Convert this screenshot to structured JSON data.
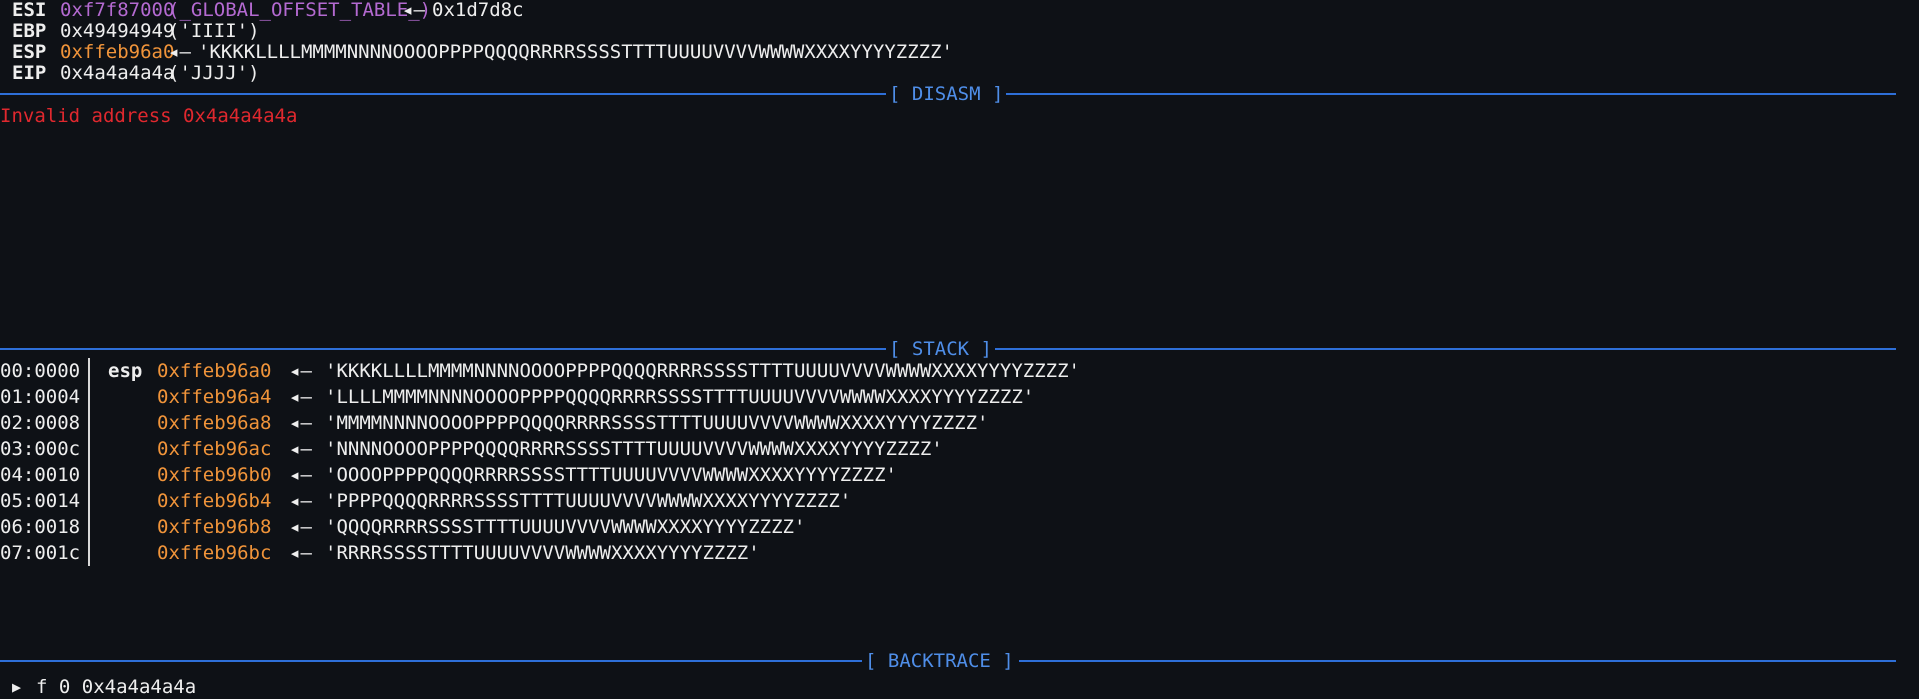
{
  "registers": [
    {
      "name": "ESI",
      "value": "0xf7f87000",
      "symbol": "(_GLOBAL_OFFSET_TABLE_)",
      "arrow": "◂—",
      "target": "0x1d7d8c"
    },
    {
      "name": "EBP",
      "value": "0x49494949",
      "symbol": "",
      "arrow": "",
      "target": "('IIII')"
    },
    {
      "name": "ESP",
      "value": "0xffeb96a0",
      "symbol": "",
      "arrow": "◂—",
      "target": "'KKKKLLLLMMMMNNNNOOOOPPPPQQQQRRRRSSSSTTTTUUUUVVVVWWWWXXXXYYYYZZZZ'"
    },
    {
      "name": "EIP",
      "value": "0x4a4a4a4a",
      "symbol": "",
      "arrow": "",
      "target": "('JJJJ')"
    }
  ],
  "sections": {
    "disasm": "[ DISASM ]",
    "stack": "[ STACK ]",
    "backtrace": "[ BACKTRACE ]"
  },
  "disasm": {
    "message": "Invalid address 0x4a4a4a4a"
  },
  "stack": [
    {
      "offset": "00:0000",
      "label": "esp",
      "addr": "0xffeb96a0",
      "arrow": "◂—",
      "value": "'KKKKLLLLMMMMNNNNOOOOPPPPQQQQRRRRSSSSTTTTUUUUVVVVWWWWXXXXYYYYZZZZ'"
    },
    {
      "offset": "01:0004",
      "label": "",
      "addr": "0xffeb96a4",
      "arrow": "◂—",
      "value": "'LLLLMMMMNNNNOOOOPPPPQQQQRRRRSSSSTTTTUUUUVVVVWWWWXXXXYYYYZZZZ'"
    },
    {
      "offset": "02:0008",
      "label": "",
      "addr": "0xffeb96a8",
      "arrow": "◂—",
      "value": "'MMMMNNNNOOOOPPPPQQQQRRRRSSSSTTTTUUUUVVVVWWWWXXXXYYYYZZZZ'"
    },
    {
      "offset": "03:000c",
      "label": "",
      "addr": "0xffeb96ac",
      "arrow": "◂—",
      "value": "'NNNNOOOOPPPPQQQQRRRRSSSSTTTTUUUUVVVVWWWWXXXXYYYYZZZZ'"
    },
    {
      "offset": "04:0010",
      "label": "",
      "addr": "0xffeb96b0",
      "arrow": "◂—",
      "value": "'OOOOPPPPQQQQRRRRSSSSTTTTUUUUVVVVWWWWXXXXYYYYZZZZ'"
    },
    {
      "offset": "05:0014",
      "label": "",
      "addr": "0xffeb96b4",
      "arrow": "◂—",
      "value": "'PPPPQQQQRRRRSSSSTTTTUUUUVVVVWWWWXXXXYYYYZZZZ'"
    },
    {
      "offset": "06:0018",
      "label": "",
      "addr": "0xffeb96b8",
      "arrow": "◂—",
      "value": "'QQQQRRRRSSSSTTTTUUUUVVVVWWWWXXXXYYYYZZZZ'"
    },
    {
      "offset": "07:001c",
      "label": "",
      "addr": "0xffeb96bc",
      "arrow": "◂—",
      "value": "'RRRRSSSSTTTTUUUUVVVVWWWWXXXXYYYYZZZZ'"
    }
  ],
  "backtrace": {
    "marker": "▶",
    "frame": "f 0 0x4a4a4a4a"
  },
  "colors": {
    "background": "#0e1116",
    "text": "#e6e6e6",
    "symbol": "#b46ad1",
    "stack_address": "#f0943a",
    "error": "#e0282e",
    "section_header": "#4f8ee8"
  }
}
